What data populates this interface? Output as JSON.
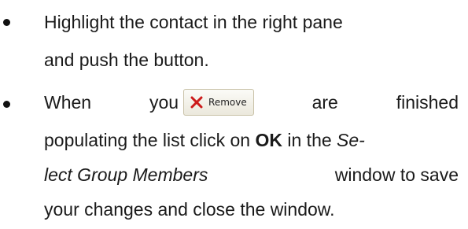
{
  "item1": {
    "line1": "Highlight the contact in the right pane",
    "line2": "and push the button."
  },
  "item2": {
    "w_when": "When",
    "w_you": "you",
    "button_label": "Remove",
    "button_icon": "x-icon",
    "button_icon_color": "#cc1a1a",
    "w_are": "are",
    "w_finished": "finished",
    "l2_a": "populating the list click on ",
    "l2_ok": "OK",
    "l2_b": " in the ",
    "l2_se": "Se-",
    "l3_lect": "lect Group Members",
    "l3_rest": " window to save",
    "l4": "your changes and close the window."
  }
}
